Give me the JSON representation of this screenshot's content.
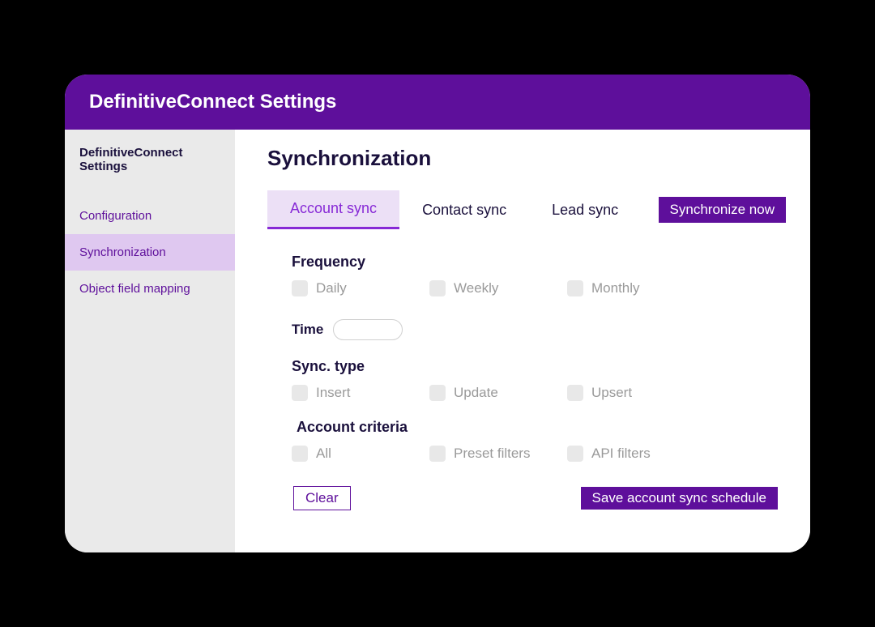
{
  "titlebar": "DefinitiveConnect Settings",
  "sidebar": {
    "title": "DefinitiveConnect Settings",
    "items": [
      {
        "label": "Configuration",
        "active": false
      },
      {
        "label": "Synchronization",
        "active": true
      },
      {
        "label": "Object field mapping",
        "active": false
      }
    ]
  },
  "main": {
    "page_title": "Synchronization",
    "tabs": [
      {
        "label": "Account sync",
        "active": true
      },
      {
        "label": "Contact sync",
        "active": false
      },
      {
        "label": "Lead sync",
        "active": false
      }
    ],
    "sync_now_label": "Synchronize now",
    "frequency": {
      "label": "Frequency",
      "options": [
        "Daily",
        "Weekly",
        "Monthly"
      ]
    },
    "time": {
      "label": "Time",
      "value": ""
    },
    "sync_type": {
      "label": "Sync. type",
      "options": [
        "Insert",
        "Update",
        "Upsert"
      ]
    },
    "account_criteria": {
      "label": "Account criteria",
      "options": [
        "All",
        "Preset filters",
        "API filters"
      ]
    },
    "clear_label": "Clear",
    "save_label": "Save account sync schedule"
  }
}
